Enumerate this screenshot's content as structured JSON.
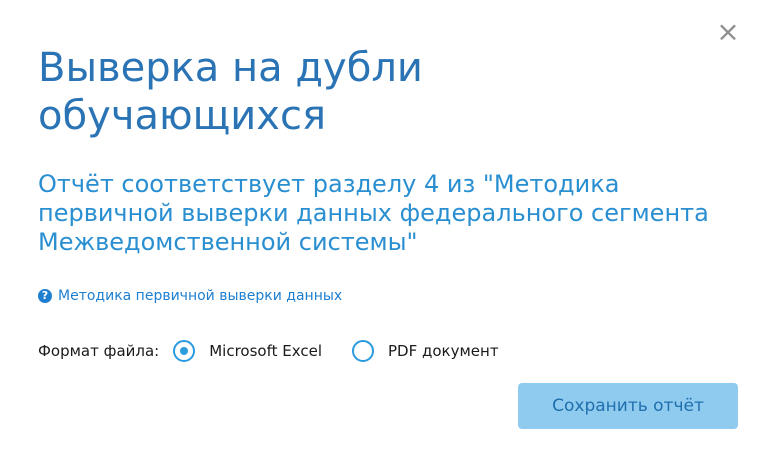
{
  "dialog": {
    "close_symbol": "×",
    "title": "Выверка на дубли обучающихся",
    "subtitle": "Отчёт соответствует разделу 4 из \"Методика первичной выверки данных федерального сегмента Межведомственной системы\"",
    "help_icon": "?",
    "help_link": "Методика первичной выверки данных",
    "format": {
      "label": "Формат файла:",
      "options": [
        {
          "label": "Microsoft Excel",
          "checked": true
        },
        {
          "label": "PDF документ",
          "checked": false
        }
      ]
    },
    "save_button": "Сохранить отчёт"
  },
  "colors": {
    "title": "#2a73b5",
    "subtitle": "#2a8fd1",
    "link": "#1e7fd0",
    "radio_accent": "#2a9bdf",
    "button_bg": "#8fcbef",
    "button_text": "#1f6fae"
  }
}
